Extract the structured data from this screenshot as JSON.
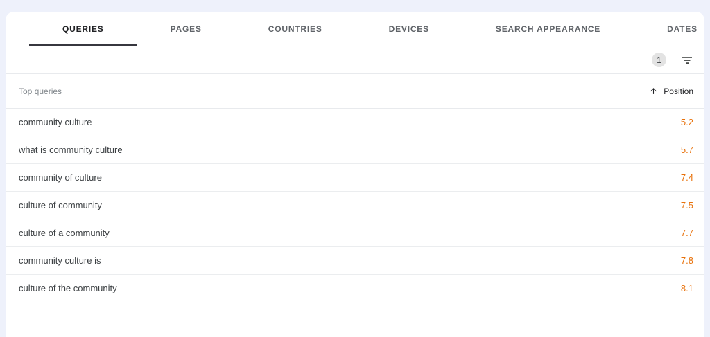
{
  "tabs": {
    "items": [
      {
        "label": "QUERIES",
        "active": true
      },
      {
        "label": "PAGES",
        "active": false
      },
      {
        "label": "COUNTRIES",
        "active": false
      },
      {
        "label": "DEVICES",
        "active": false
      },
      {
        "label": "SEARCH APPEARANCE",
        "active": false
      },
      {
        "label": "DATES",
        "active": false
      }
    ]
  },
  "filter_bar": {
    "active_filter_count": "1",
    "filter_icon": "filter-list-icon"
  },
  "table": {
    "query_header": "Top queries",
    "metric_header": "Position",
    "sort_direction": "ascending",
    "sort_icon": "arrow-upward-icon",
    "rows": [
      {
        "query": "community culture",
        "position": "5.2"
      },
      {
        "query": "what is community culture",
        "position": "5.7"
      },
      {
        "query": "community of culture",
        "position": "7.4"
      },
      {
        "query": "culture of community",
        "position": "7.5"
      },
      {
        "query": "culture of a community",
        "position": "7.7"
      },
      {
        "query": "community culture is",
        "position": "7.8"
      },
      {
        "query": "culture of the community",
        "position": "8.1"
      }
    ]
  },
  "colors": {
    "page_background": "#eef1fb",
    "card_background": "#ffffff",
    "position_value": "#e8710a",
    "active_tab": "#202124",
    "divider": "#e8eaed"
  }
}
